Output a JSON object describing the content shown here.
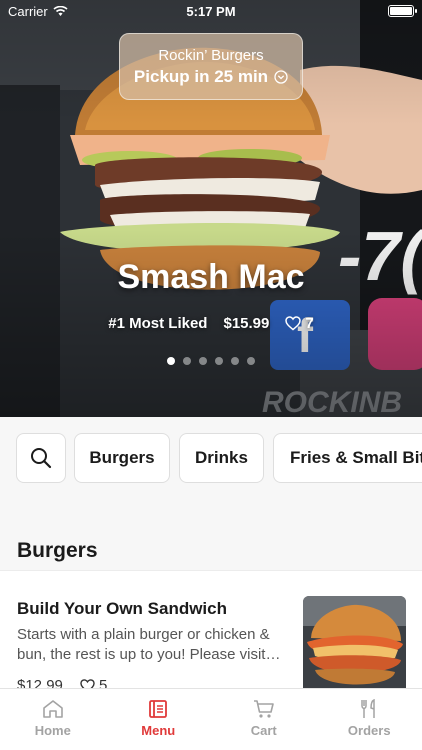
{
  "status_bar": {
    "carrier": "Carrier",
    "time": "5:17 PM"
  },
  "pickup": {
    "restaurant": "Rockin’ Burgers",
    "time": "Pickup in 25 min"
  },
  "hero": {
    "title": "Smash Mac",
    "badge": "#1 Most Liked",
    "price": "$15.99",
    "likes": "7",
    "slide_count": 6,
    "active_slide": 0
  },
  "categories": {
    "search_icon": "search-icon",
    "items": [
      "Burgers",
      "Drinks",
      "Fries & Small Bites"
    ]
  },
  "section": {
    "title": "Burgers"
  },
  "item": {
    "name": "Build Your Own Sandwich",
    "description": "Starts with a plain burger or chicken & bun, the rest is up to you! Please visit…",
    "price": "$12.99",
    "likes": "5"
  },
  "tabs": [
    {
      "label": "Home",
      "icon": "home-icon",
      "active": false
    },
    {
      "label": "Menu",
      "icon": "menu-book-icon",
      "active": true
    },
    {
      "label": "Cart",
      "icon": "cart-icon",
      "active": false
    },
    {
      "label": "Orders",
      "icon": "fork-knife-icon",
      "active": false
    }
  ],
  "colors": {
    "accent": "#e03a3a",
    "inactive": "#a3a3a3"
  }
}
